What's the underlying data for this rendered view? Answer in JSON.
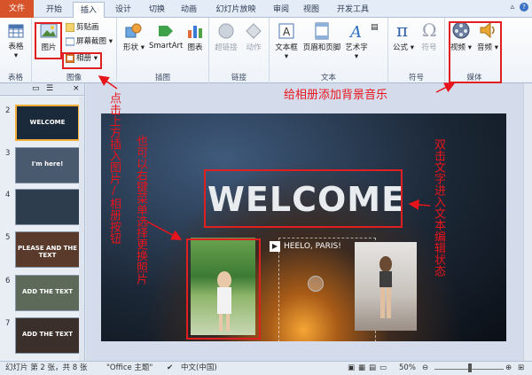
{
  "tabs": [
    "文件",
    "开始",
    "插入",
    "设计",
    "切换",
    "动画",
    "幻灯片放映",
    "审阅",
    "视图",
    "开发工具"
  ],
  "active_tab": "插入",
  "groups": {
    "table": {
      "label": "表格",
      "btn": "表格"
    },
    "image": {
      "label": "图像",
      "picture": "图片",
      "clip": "剪贴画",
      "screenshot": "屏幕截图",
      "album": "相册"
    },
    "illustration": {
      "label": "插图",
      "shapes": "形状",
      "smartart": "SmartArt",
      "chart": "图表"
    },
    "links": {
      "label": "链接",
      "hyperlink": "超链接",
      "action": "动作"
    },
    "text": {
      "label": "文本",
      "textbox": "文本框",
      "headerfooter": "页眉和页脚",
      "wordart": "艺术字"
    },
    "symbols": {
      "label": "符号",
      "equation": "公式",
      "symbol": "符号"
    },
    "media": {
      "label": "媒体",
      "video": "视频",
      "audio": "音频"
    }
  },
  "slides": [
    {
      "num": "2",
      "caption": "WELCOME",
      "color": "#1b2a3a",
      "selected": true
    },
    {
      "num": "3",
      "caption": "I'm here!",
      "color": "#4a5a6e",
      "selected": false
    },
    {
      "num": "4",
      "caption": "",
      "color": "#2e3d4e",
      "selected": false
    },
    {
      "num": "5",
      "caption": "PLEASE AND THE TEXT",
      "color": "#5a3a2a",
      "selected": false
    },
    {
      "num": "6",
      "caption": "ADD THE TEXT",
      "color": "#5d6a5a",
      "selected": false
    },
    {
      "num": "7",
      "caption": "ADD THE TEXT",
      "color": "#3a2f2a",
      "selected": false
    }
  ],
  "slide_main": {
    "title": "WELCOME",
    "subtitle": "HEELO, PARIS!"
  },
  "status": {
    "slide_info": "幻灯片 第 2 张，共 8 张",
    "theme": "\"Office 主题\"",
    "language": "中文(中国)",
    "zoom": "50%"
  },
  "annotations": {
    "music": "给相册添加背景音乐",
    "click_insert": "点击上方插入图片/相册按钮",
    "right_menu": "也可以右键菜单选择更换照片",
    "double_click": "双击文字进入文本编辑状态"
  },
  "colors": {
    "annotation": "#e8141c",
    "file_tab": "#d7542b"
  }
}
